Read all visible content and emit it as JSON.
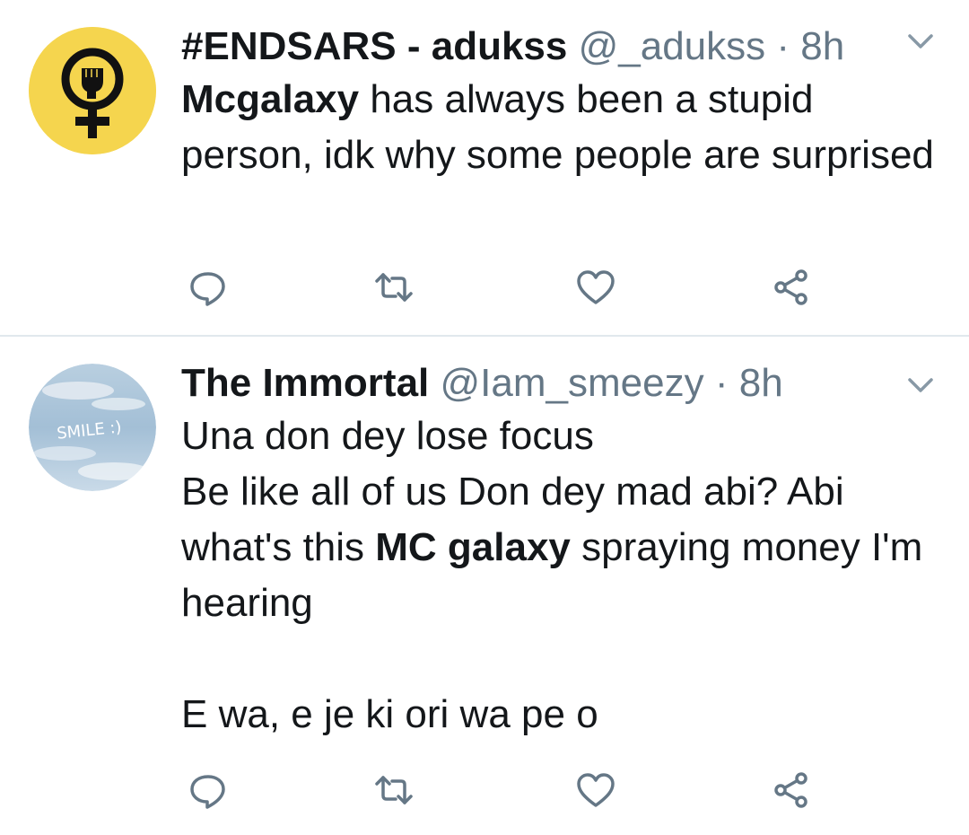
{
  "tweets": [
    {
      "display_name": "#ENDSARS - adukss",
      "handle": "@_adukss",
      "separator": "·",
      "time": "8h",
      "text_parts": [
        "Mcgalaxy",
        " has always been a stupid person, idk why some people are surprised"
      ],
      "avatar": "feminist-fist-symbol",
      "actions": [
        "reply-icon",
        "retweet-icon",
        "like-icon",
        "share-icon"
      ]
    },
    {
      "display_name": "The Immortal",
      "handle": "@Iam_smeezy",
      "separator": "·",
      "time": "8h",
      "text_parts": [
        "Una don dey lose focus\nBe like all of us Don dey mad abi? Abi what's this ",
        "MC galaxy",
        " spraying money I'm hearing\n\nE wa, e je ki ori wa pe o"
      ],
      "avatar": "sky-clouds-smile",
      "avatar_text": "SMILE :)",
      "actions": [
        "reply-icon",
        "retweet-icon",
        "like-icon",
        "share-icon"
      ]
    }
  ],
  "colors": {
    "text_primary": "#14171a",
    "text_secondary": "#657786",
    "divider": "#e1e8ed",
    "avatar_yellow": "#f5d54e"
  }
}
